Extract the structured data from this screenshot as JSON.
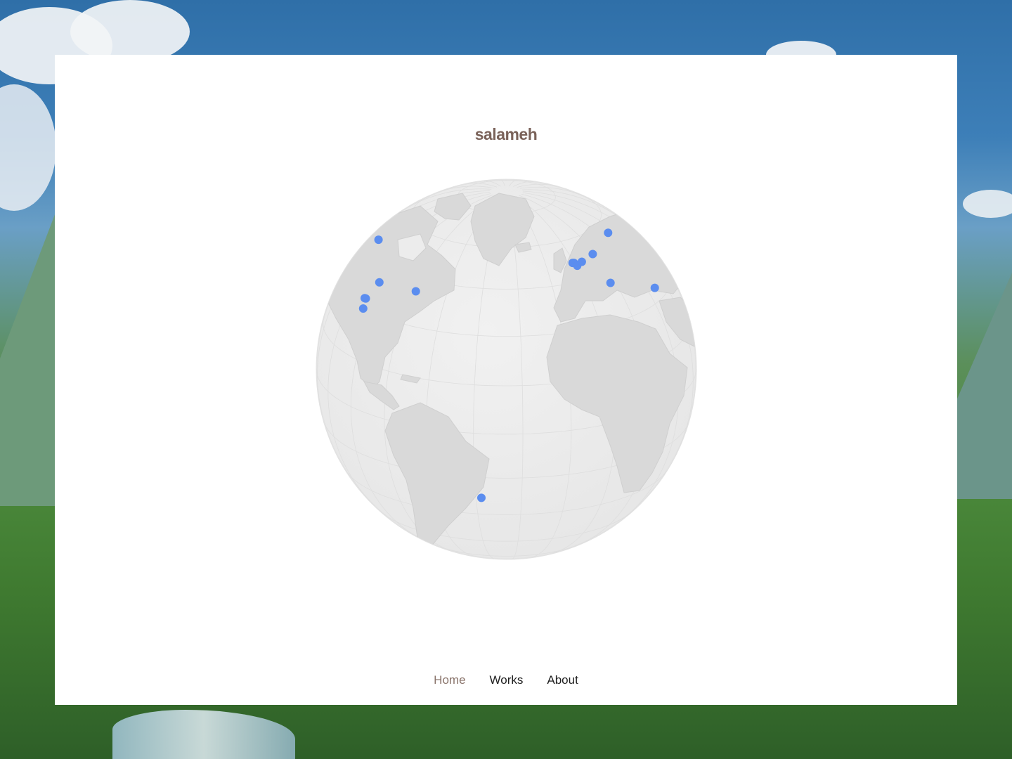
{
  "site": {
    "title": "salameh"
  },
  "nav": {
    "items": [
      {
        "label": "Home",
        "active": true
      },
      {
        "label": "Works",
        "active": false
      },
      {
        "label": "About",
        "active": false
      }
    ]
  },
  "globe": {
    "marker_color": "#5b8def",
    "land_color": "#dcdcdc",
    "ocean_color": "#ededed",
    "center": {
      "lat": 20,
      "lon": -35
    },
    "markers": [
      {
        "lat": 47.6,
        "lon": -122.3
      },
      {
        "lat": 40.7,
        "lon": -74.0
      },
      {
        "lat": 39.1,
        "lon": -94.6
      },
      {
        "lat": 32.8,
        "lon": -96.8
      },
      {
        "lat": 32.7,
        "lon": -97.5
      },
      {
        "lat": 29.8,
        "lon": -95.4
      },
      {
        "lat": 51.5,
        "lon": -0.1
      },
      {
        "lat": 51.6,
        "lon": -0.8
      },
      {
        "lat": 50.3,
        "lon": 0.8
      },
      {
        "lat": 51.2,
        "lon": 4.4
      },
      {
        "lat": 52.5,
        "lon": 13.4
      },
      {
        "lat": 41.9,
        "lon": 12.5
      },
      {
        "lat": 55.8,
        "lon": 37.6
      },
      {
        "lat": 33.9,
        "lon": 35.5
      },
      {
        "lat": -22.9,
        "lon": -43.2
      }
    ]
  }
}
